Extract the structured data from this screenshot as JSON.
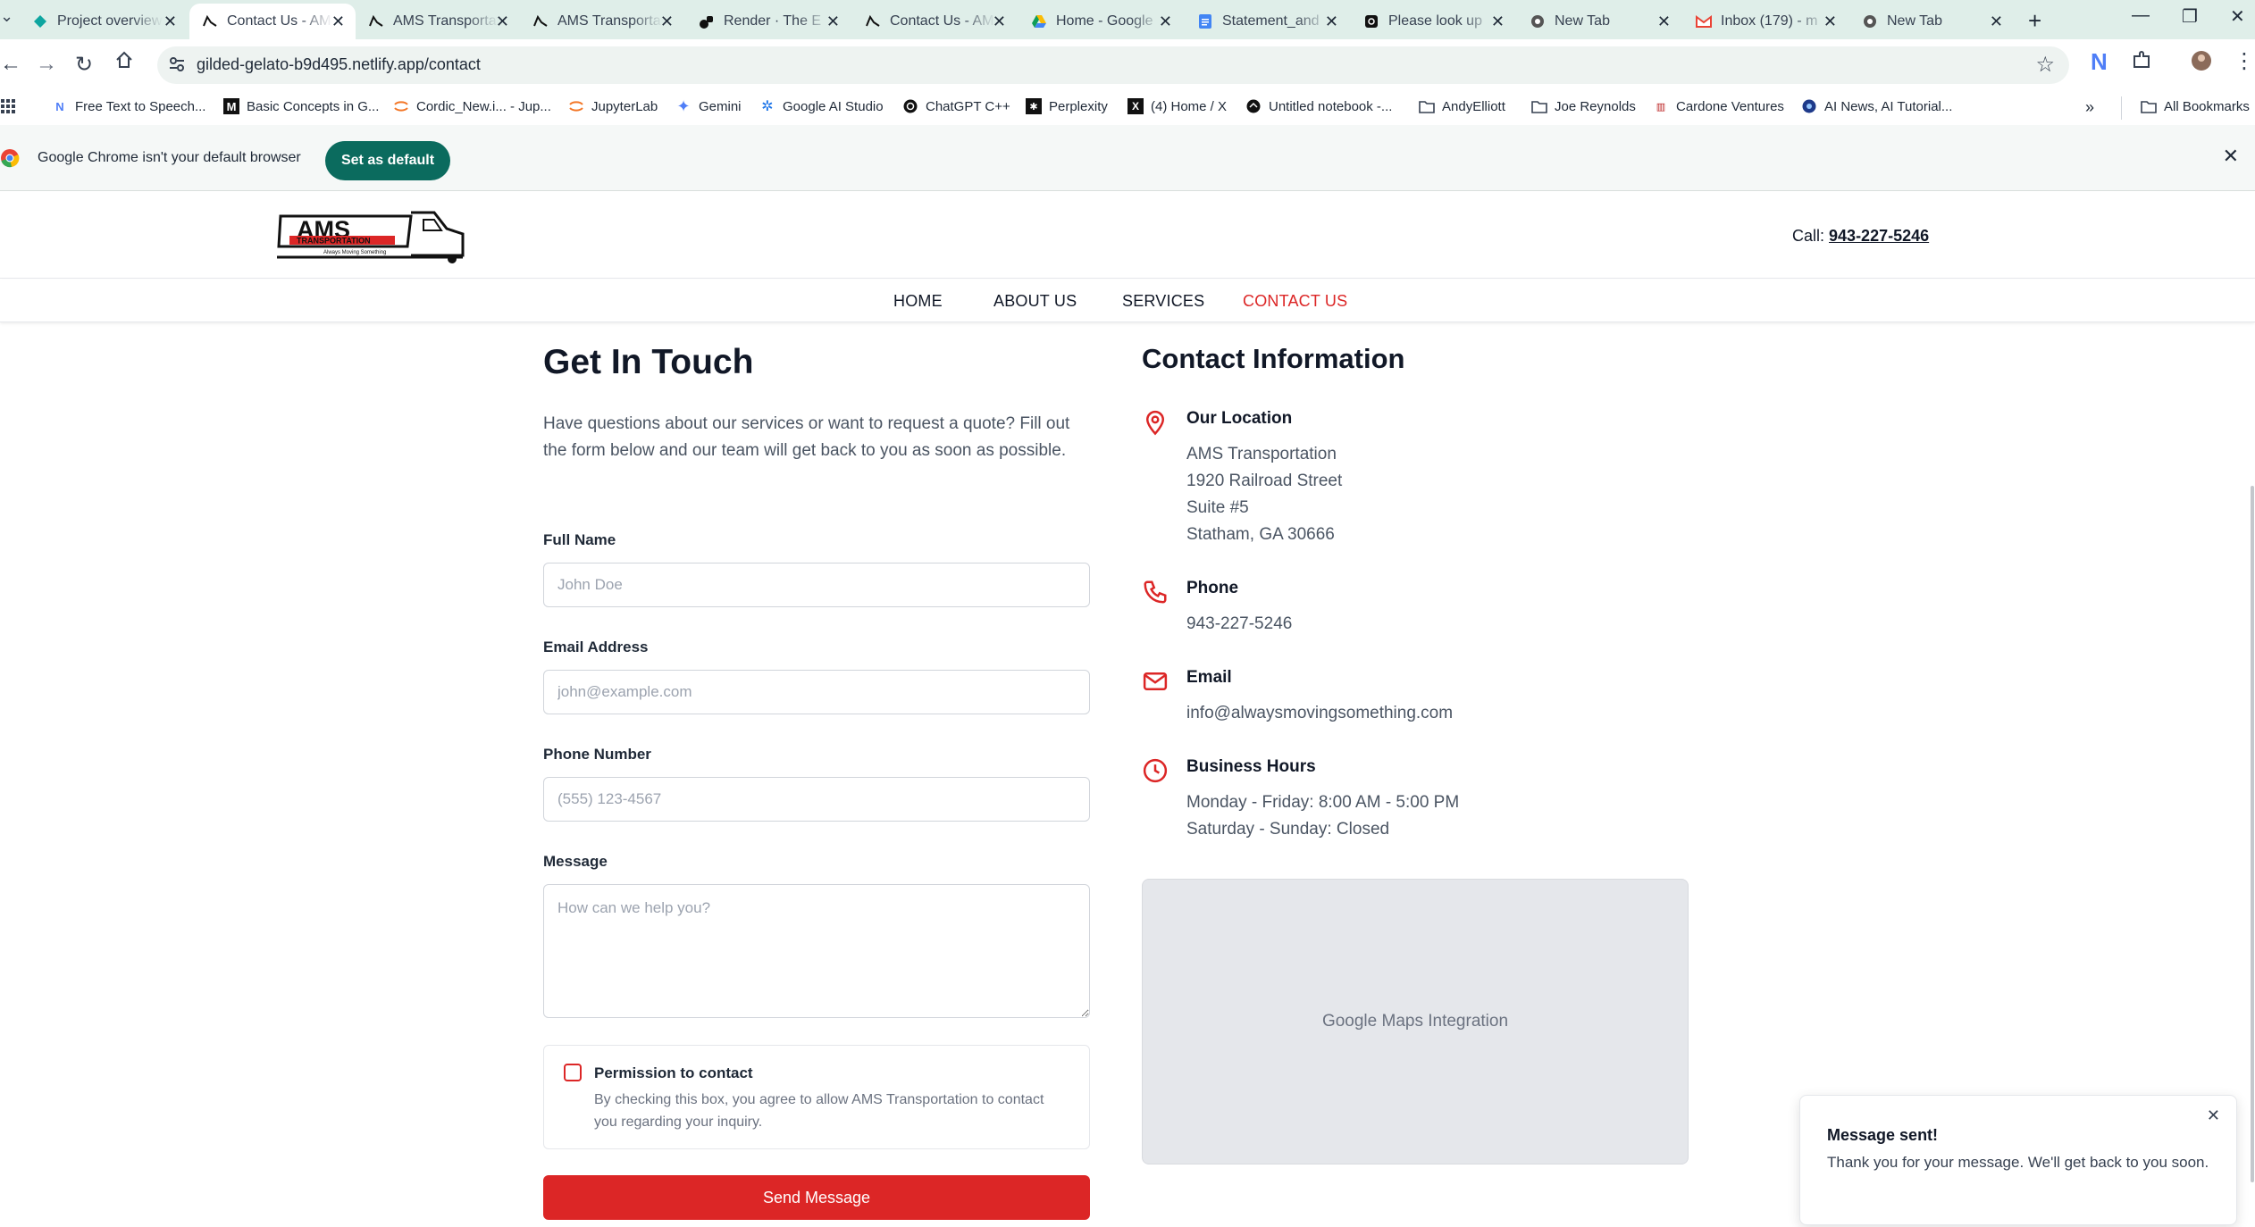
{
  "browser": {
    "tabs": [
      {
        "title": "Project overview",
        "icon": "diamond-icon"
      },
      {
        "title": "Contact Us - AMS",
        "icon": "truck-icon",
        "active": true
      },
      {
        "title": "AMS Transportation",
        "icon": "truck-icon"
      },
      {
        "title": "AMS Transportation",
        "icon": "truck-icon"
      },
      {
        "title": "Render · The E",
        "icon": "render-icon"
      },
      {
        "title": "Contact Us - AMS",
        "icon": "truck-icon"
      },
      {
        "title": "Home - Google",
        "icon": "drive-icon"
      },
      {
        "title": "Statement_and",
        "icon": "docs-icon"
      },
      {
        "title": "Please look up",
        "icon": "ai-icon"
      },
      {
        "title": "New Tab",
        "icon": "chrome-icon"
      },
      {
        "title": "Inbox (179) - m",
        "icon": "gmail-icon"
      },
      {
        "title": "New Tab",
        "icon": "chrome-icon"
      }
    ],
    "url": "gilded-gelato-b9d495.netlify.app/contact",
    "bookmarks": [
      {
        "label": "Free Text to Speech..."
      },
      {
        "label": "Basic Concepts in G..."
      },
      {
        "label": "Cordic_New.i... - Jup..."
      },
      {
        "label": "JupyterLab"
      },
      {
        "label": "Gemini"
      },
      {
        "label": "Google AI Studio"
      },
      {
        "label": "ChatGPT C++"
      },
      {
        "label": "Perplexity"
      },
      {
        "label": "(4) Home / X"
      },
      {
        "label": "Untitled notebook -..."
      },
      {
        "label": "AndyElliott"
      },
      {
        "label": "Joe Reynolds"
      },
      {
        "label": "Cardone Ventures"
      },
      {
        "label": "AI News, AI Tutorial..."
      },
      {
        "label": "All Bookmarks"
      }
    ],
    "infobar": {
      "text": "Google Chrome isn't your default browser",
      "button": "Set as default"
    }
  },
  "site": {
    "logo_text": "AMS",
    "logo_sub": "TRANSPORTATION",
    "logo_tag": "Always Moving Something",
    "call_label": "Call:",
    "call_number": "943-227-5246",
    "nav": [
      {
        "label": "HOME"
      },
      {
        "label": "ABOUT US"
      },
      {
        "label": "SERVICES"
      },
      {
        "label": "CONTACT US",
        "active": true
      }
    ],
    "form": {
      "heading": "Get In Touch",
      "intro": "Have questions about our services or want to request a quote? Fill out the form below and our team will get back to you as soon as possible.",
      "full_name_label": "Full Name",
      "full_name_placeholder": "John Doe",
      "email_label": "Email Address",
      "email_placeholder": "john@example.com",
      "phone_label": "Phone Number",
      "phone_placeholder": "(555) 123-4567",
      "message_label": "Message",
      "message_placeholder": "How can we help you?",
      "consent_title": "Permission to contact",
      "consent_text": "By checking this box, you agree to allow AMS Transportation to contact you regarding your inquiry.",
      "consent_checked": false,
      "submit_label": "Send Message"
    },
    "contact": {
      "heading": "Contact Information",
      "location_title": "Our Location",
      "location_lines": [
        "AMS Transportation",
        "1920 Railroad Street",
        "Suite #5",
        "Statham, GA 30666"
      ],
      "phone_title": "Phone",
      "phone": "943-227-5246",
      "email_title": "Email",
      "email": "info@alwaysmovingsomething.com",
      "hours_title": "Business Hours",
      "hours_lines": [
        "Monday - Friday: 8:00 AM - 5:00 PM",
        "Saturday - Sunday: Closed"
      ],
      "map_label": "Google Maps Integration"
    },
    "toast": {
      "title": "Message sent!",
      "body": "Thank you for your message. We'll get back to you soon."
    }
  },
  "colors": {
    "accent": "#dc2626",
    "infobar_button": "#0b6b5e",
    "tabbar": "#dfeee9"
  }
}
